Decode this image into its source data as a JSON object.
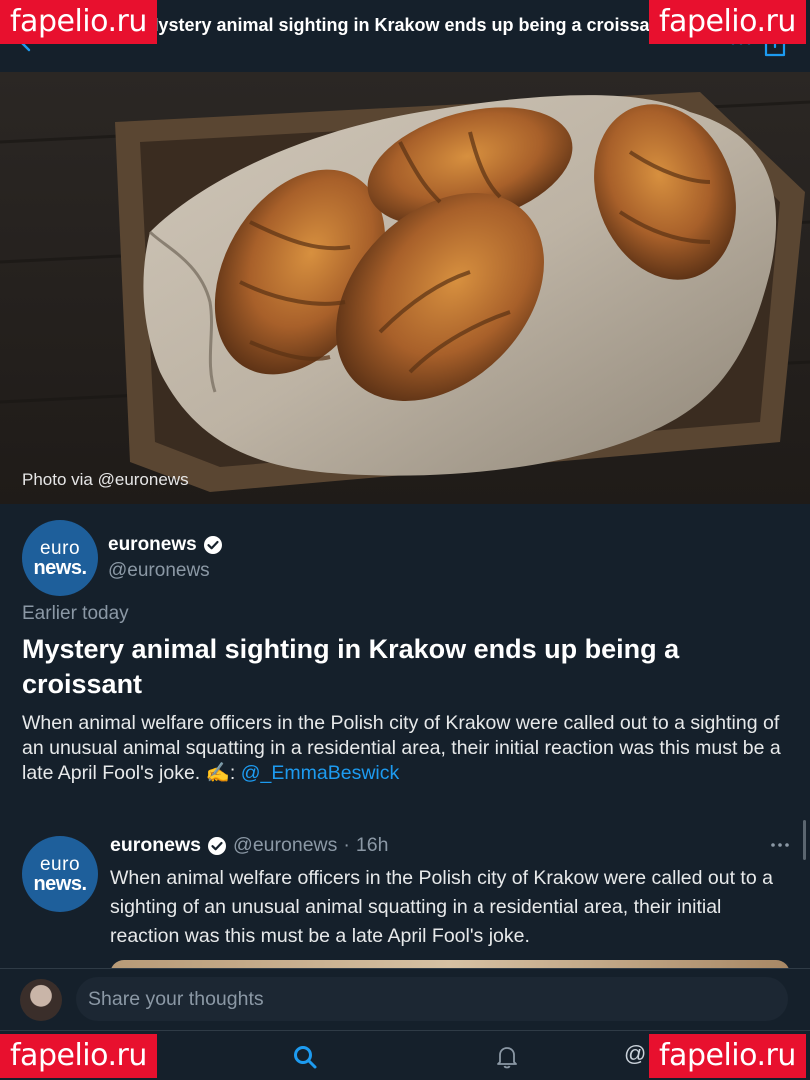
{
  "header": {
    "title": "Mystery animal sighting in Krakow ends up being a croissant"
  },
  "hero": {
    "photo_credit": "Photo via @euronews"
  },
  "article": {
    "author": {
      "avatar_line1": "euro",
      "avatar_line2": "news.",
      "name": "euronews",
      "handle": "@euronews"
    },
    "timestamp": "Earlier today",
    "headline": "Mystery animal sighting in Krakow ends up being a croissant",
    "summary": "When animal welfare officers in the Polish city of Krakow were called out to a sighting of an unusual animal squatting in a residential area, their initial reaction was this must be a late April Fool's joke. ✍️: ",
    "summary_mention": "@_EmmaBeswick"
  },
  "tweet": {
    "avatar_line1": "euro",
    "avatar_line2": "news.",
    "name": "euronews",
    "handle": "@euronews",
    "separator": "·",
    "time": "16h",
    "text": "When animal welfare officers in the Polish city of Krakow were called out to a sighting of an unusual animal squatting in a residential area, their initial reaction was this must be a late April Fool's joke."
  },
  "composer": {
    "placeholder": "Share your thoughts"
  },
  "tabbar": {
    "messages_partial": "@"
  },
  "watermarks": {
    "text": "fapelio.ru"
  },
  "colors": {
    "background": "#15202b",
    "accent": "#1d9bf0",
    "secondary_text": "#8b98a5",
    "euronews_blue": "#1e5f9b",
    "watermark_red": "#e8102e"
  },
  "icons": [
    "back-arrow-icon",
    "more-icon",
    "share-icon",
    "verified-icon",
    "home-icon",
    "search-icon",
    "bell-icon"
  ]
}
